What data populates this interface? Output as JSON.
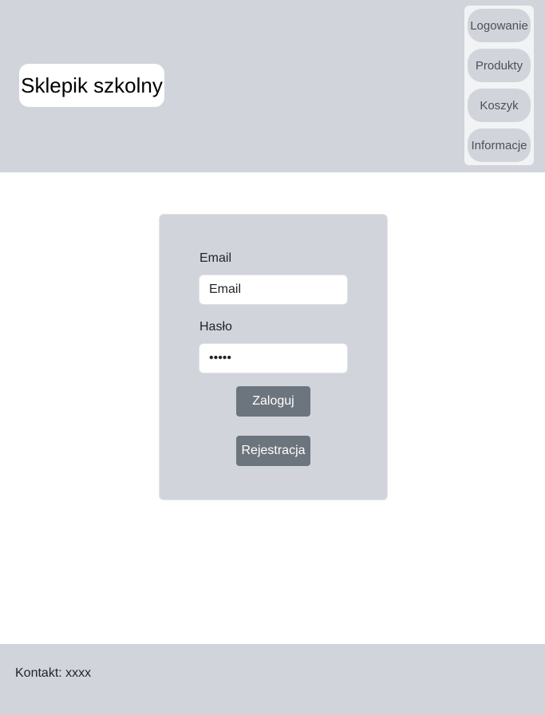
{
  "header": {
    "brand": "Sklepik szkolny",
    "nav": [
      {
        "label": "Logowanie"
      },
      {
        "label": "Produkty"
      },
      {
        "label": "Koszyk"
      },
      {
        "label": "Informacje"
      }
    ]
  },
  "login": {
    "email_label": "Email",
    "email_placeholder": "Email",
    "email_value": "",
    "password_label": "Hasło",
    "password_value": "12345",
    "login_button": "Zaloguj",
    "register_button": "Rejestracja"
  },
  "footer": {
    "contact": "Kontakt: xxxx"
  },
  "colors": {
    "panel": "#d1d5db",
    "button": "#6c757d"
  }
}
